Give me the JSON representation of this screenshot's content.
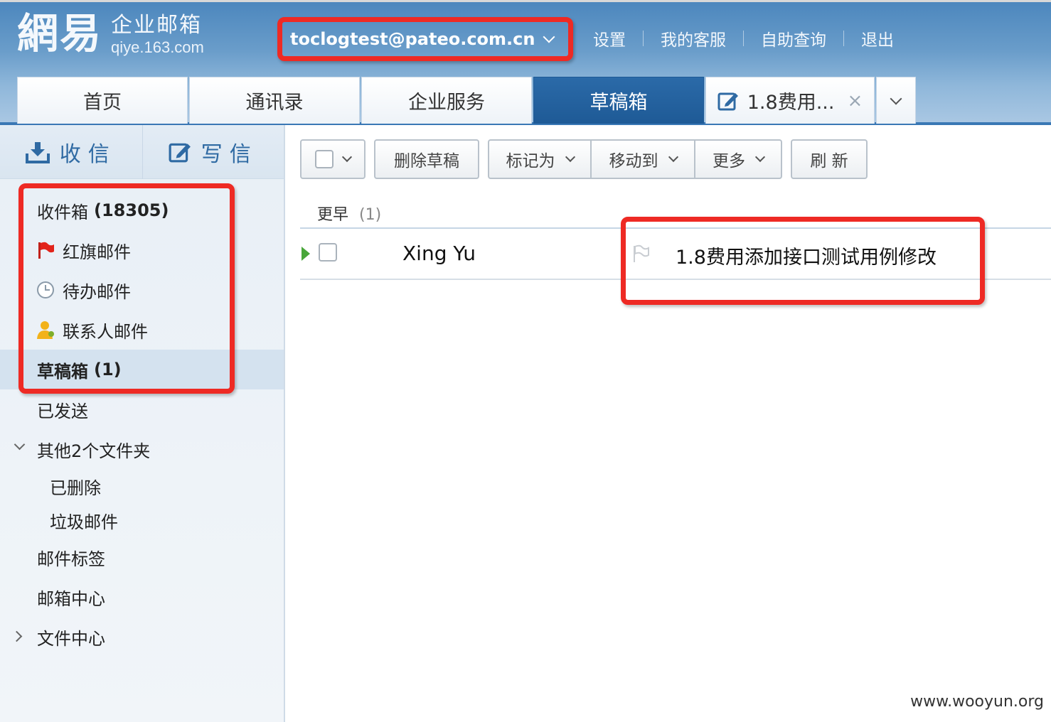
{
  "header": {
    "logo_main": "網易",
    "logo_cn": "企业邮箱",
    "logo_en": "qiye.163.com",
    "account": "toclogtest@pateo.com.cn",
    "links": [
      "设置",
      "我的客服",
      "自助查询",
      "退出"
    ]
  },
  "tabs": [
    {
      "label": "首页",
      "active": false
    },
    {
      "label": "通讯录",
      "active": false
    },
    {
      "label": "企业服务",
      "active": false
    },
    {
      "label": "草稿箱",
      "active": true
    },
    {
      "label": "1.8费用...",
      "active": false,
      "icon": "compose-icon",
      "closable": true
    }
  ],
  "tab_close": "×",
  "sidebar": {
    "receive": "收信",
    "write": "写信",
    "folders": {
      "inbox": {
        "label": "收件箱",
        "count": "(18305)"
      },
      "flagged": {
        "label": "红旗邮件",
        "icon": "red-flag-icon"
      },
      "todo": {
        "label": "待办邮件",
        "icon": "clock-icon"
      },
      "contacts": {
        "label": "联系人邮件",
        "icon": "contact-person-icon"
      },
      "drafts": {
        "label": "草稿箱",
        "count": "(1)"
      },
      "sent": {
        "label": "已发送"
      },
      "other": {
        "label": "其他2个文件夹"
      },
      "deleted": {
        "label": "已删除"
      },
      "junk": {
        "label": "垃圾邮件"
      },
      "tags": {
        "label": "邮件标签"
      },
      "mailbox_center": {
        "label": "邮箱中心"
      },
      "file_center": {
        "label": "文件中心"
      }
    }
  },
  "toolbar": {
    "delete_draft": "删除草稿",
    "mark_as": "标记为",
    "move_to": "移动到",
    "more": "更多",
    "refresh": "刷 新"
  },
  "list": {
    "group_label": "更早",
    "group_count": "(1)",
    "rows": [
      {
        "sender": "Xing Yu",
        "subject": "1.8费用添加接口测试用例修改"
      }
    ]
  },
  "watermark": "www.wooyun.org",
  "colors": {
    "accent": "#1e5a96",
    "annotation": "#ee2a24",
    "link_blue": "#2f6aa3"
  }
}
